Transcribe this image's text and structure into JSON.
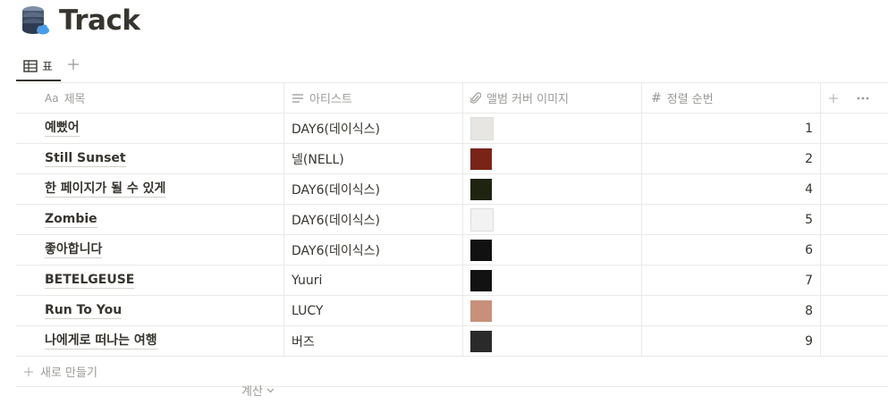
{
  "page": {
    "title": "Track"
  },
  "view_tabs": {
    "active_label": "표"
  },
  "columns": [
    {
      "label": "제목",
      "icon": "aa-text-icon"
    },
    {
      "label": "아티스트",
      "icon": "lines-icon"
    },
    {
      "label": "앨범 커버 이미지",
      "icon": "paperclip-icon"
    },
    {
      "label": "정렬 순번",
      "icon": "hash-icon"
    }
  ],
  "rows": [
    {
      "title": "예뻤어",
      "artist": "DAY6(데이식스)",
      "order": "1",
      "cover_color": "#e8e6e2"
    },
    {
      "title": "Still Sunset",
      "artist": "넬(NELL)",
      "order": "2",
      "cover_color": "#7a2418"
    },
    {
      "title": "한 페이지가 될 수 있게",
      "artist": "DAY6(데이식스)",
      "order": "4",
      "cover_color": "#1e2410"
    },
    {
      "title": "Zombie",
      "artist": "DAY6(데이식스)",
      "order": "5",
      "cover_color": "#f2f2f2"
    },
    {
      "title": "좋아합니다",
      "artist": "DAY6(데이식스)",
      "order": "6",
      "cover_color": "#111111"
    },
    {
      "title": "BETELGEUSE",
      "artist": "Yuuri",
      "order": "7",
      "cover_color": "#121212"
    },
    {
      "title": "Run To You",
      "artist": "LUCY",
      "order": "8",
      "cover_color": "#c8907a"
    },
    {
      "title": "나에게로 떠나는 여행",
      "artist": "버즈",
      "order": "9",
      "cover_color": "#2a2a2a"
    }
  ],
  "footer": {
    "new_label": "새로 만들기",
    "calc_label": "계산"
  },
  "colors": {
    "text": "#37352f",
    "muted": "#9b9a97",
    "border": "#e9e9e7"
  }
}
